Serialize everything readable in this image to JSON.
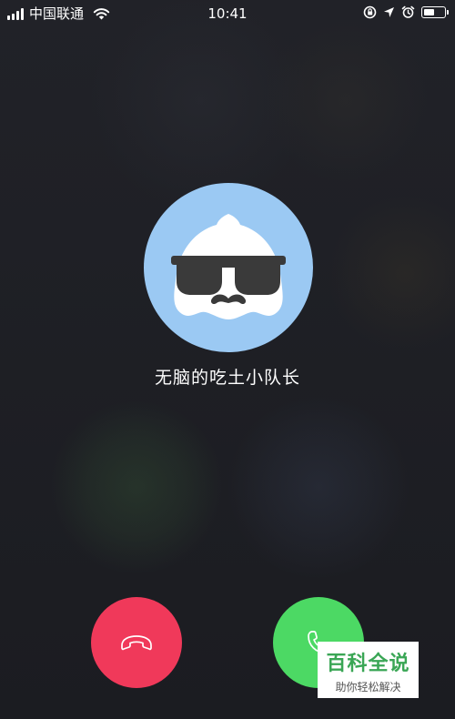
{
  "status_bar": {
    "carrier": "中国联通",
    "time": "10:41",
    "battery_level": 0.55
  },
  "caller": {
    "name": "无脑的吃土小队长"
  },
  "actions": {
    "decline_icon": "phone-hangup-icon",
    "accept_icon": "phone-icon"
  },
  "watermark": {
    "title": "百科全说",
    "subtitle": "助你轻松解决"
  },
  "colors": {
    "decline": "#f0395a",
    "accept": "#4cd964",
    "avatar_bg": "#9bc9f3",
    "watermark_green": "#3aa655"
  }
}
